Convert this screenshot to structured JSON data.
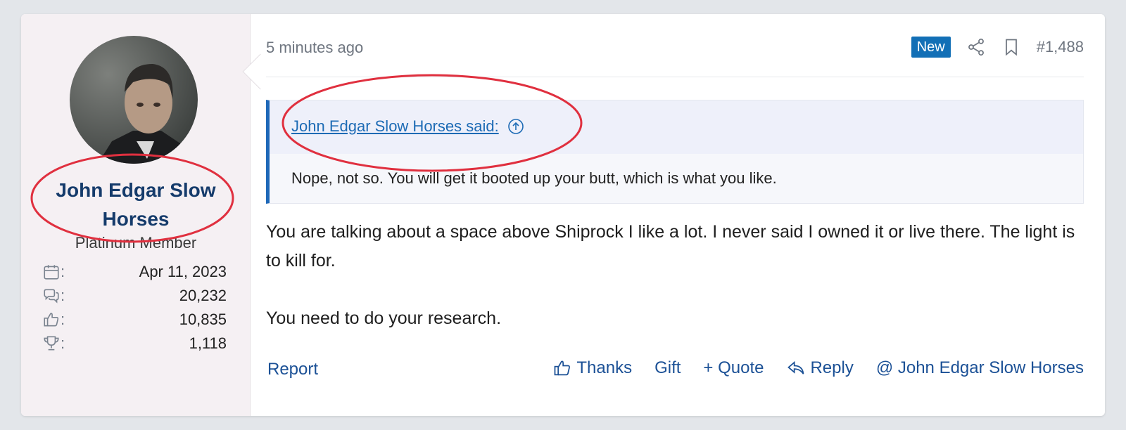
{
  "user": {
    "name_line1": "John Edgar Slow",
    "name_line2": "Horses",
    "title": "Platinum Member",
    "stats": [
      {
        "icon": "calendar-icon",
        "sep": ":",
        "value": "Apr 11, 2023"
      },
      {
        "icon": "messages-icon",
        "sep": ":",
        "value": "20,232"
      },
      {
        "icon": "thumbs-up-icon",
        "sep": ":",
        "value": "10,835"
      },
      {
        "icon": "trophy-icon",
        "sep": ":",
        "value": "1,118"
      }
    ]
  },
  "post": {
    "time": "5 minutes ago",
    "badge": "New",
    "number": "#1,488"
  },
  "quote": {
    "attribution": "John Edgar Slow Horses said:",
    "text": "Nope, not so. You will get it booted up your butt, which is what you like."
  },
  "message": {
    "p1": "You are talking about a space above Shiprock I like a lot. I never said I owned it or live there. The light is to kill for.",
    "p2": "You need to do your research."
  },
  "footer": {
    "report": "Report",
    "thanks": "Thanks",
    "gift": "Gift",
    "quote": "+ Quote",
    "reply": "Reply",
    "mention": "@ John Edgar Slow Horses"
  },
  "colors": {
    "link": "#1c5196",
    "username": "#153b6b",
    "badge": "#126fb6",
    "quote_border": "#1e68b8",
    "annotation": "#e0303f"
  }
}
